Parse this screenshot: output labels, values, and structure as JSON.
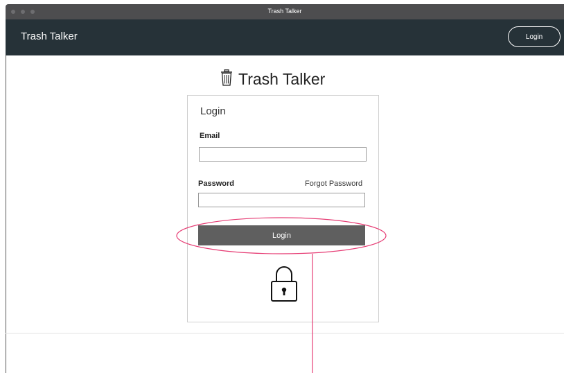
{
  "window": {
    "title": "Trash Talker"
  },
  "navbar": {
    "brand": "Trash Talker",
    "login_label": "Login"
  },
  "page": {
    "heading": "Trash Talker",
    "heading_icon": "trash-can-icon"
  },
  "login_form": {
    "title": "Login",
    "email_label": "Email",
    "email_value": "",
    "password_label": "Password",
    "password_value": "",
    "forgot_password": "Forgot Password",
    "submit_label": "Login",
    "lock_icon": "lock-icon"
  },
  "colors": {
    "navbar_bg": "#263238",
    "button_bg": "#5f5f5f",
    "annotation": "#e63c74"
  }
}
